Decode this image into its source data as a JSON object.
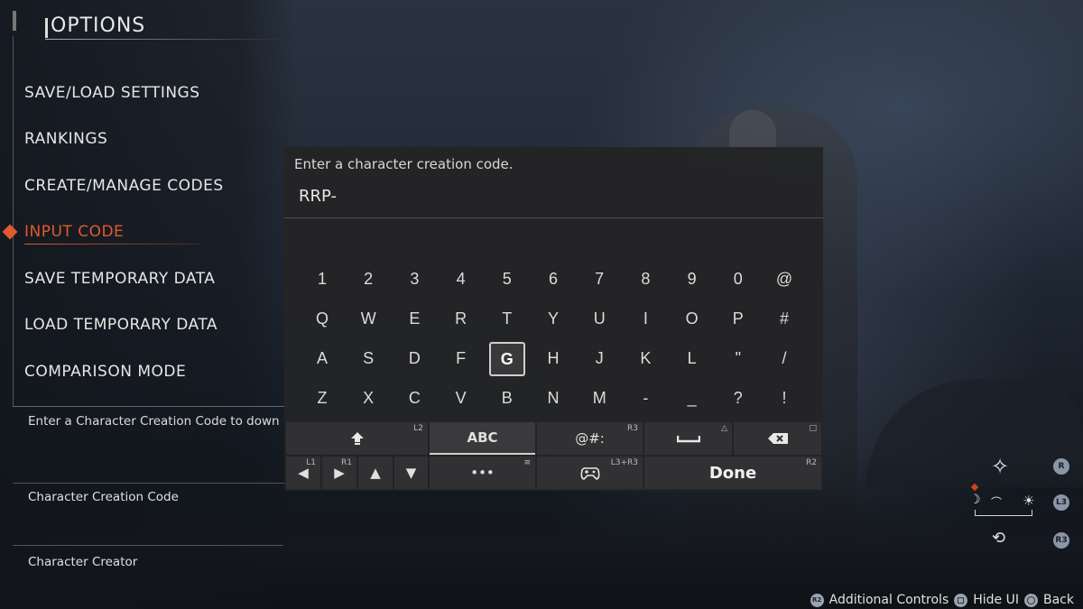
{
  "options": {
    "title": "OPTIONS",
    "menu": [
      {
        "label": "SAVE/LOAD SETTINGS",
        "active": false
      },
      {
        "label": "RANKINGS",
        "active": false
      },
      {
        "label": "CREATE/MANAGE CODES",
        "active": false
      },
      {
        "label": "INPUT CODE",
        "active": true
      },
      {
        "label": "SAVE TEMPORARY DATA",
        "active": false
      },
      {
        "label": "LOAD TEMPORARY DATA",
        "active": false
      },
      {
        "label": "COMPARISON MODE",
        "active": false
      }
    ],
    "description": "Enter a Character Creation Code to down",
    "sections": [
      "Character Creation Code",
      "Character Creator"
    ]
  },
  "keyboard": {
    "prompt": "Enter a character creation code.",
    "input_value": "RRP-",
    "rows": [
      [
        "1",
        "2",
        "3",
        "4",
        "5",
        "6",
        "7",
        "8",
        "9",
        "0",
        "@"
      ],
      [
        "Q",
        "W",
        "E",
        "R",
        "T",
        "Y",
        "U",
        "I",
        "O",
        "P",
        "#"
      ],
      [
        "A",
        "S",
        "D",
        "F",
        "G",
        "H",
        "J",
        "K",
        "L",
        "\"",
        "/"
      ],
      [
        "Z",
        "X",
        "C",
        "V",
        "B",
        "N",
        "M",
        "-",
        "_",
        "?",
        "!"
      ]
    ],
    "focused_key": "G",
    "mode_abc": "ABC",
    "mode_symbols": "@#:",
    "done_label": "Done",
    "hints": {
      "shift": "L2",
      "symbols": "R3",
      "space": "△",
      "backspace": "□",
      "left": "L1",
      "right": "R1",
      "more": "≡",
      "controller": "L3+R3",
      "done": "R2"
    },
    "more_label": "•••"
  },
  "hud": {
    "btn_r": "R",
    "btn_l3": "L3",
    "btn_r3": "R3"
  },
  "controls": [
    {
      "button": "R2",
      "label": "Additional Controls"
    },
    {
      "button": "square",
      "label": "Hide UI"
    },
    {
      "button": "circle",
      "label": "Back"
    }
  ],
  "colors": {
    "accent": "#e05a2c",
    "dialog_bg": "#242426"
  }
}
